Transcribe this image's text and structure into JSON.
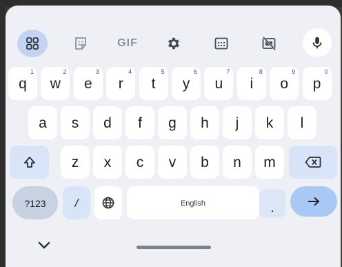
{
  "toolbar": {
    "items": [
      "apps-grid",
      "sticker",
      "gif",
      "settings",
      "clipboard",
      "floating-keyboard",
      "voice-input"
    ],
    "gif_label": "GIF"
  },
  "rows": {
    "row1": [
      {
        "label": "q",
        "hint": "1"
      },
      {
        "label": "w",
        "hint": "2"
      },
      {
        "label": "e",
        "hint": "3"
      },
      {
        "label": "r",
        "hint": "4"
      },
      {
        "label": "t",
        "hint": "5"
      },
      {
        "label": "y",
        "hint": "6"
      },
      {
        "label": "u",
        "hint": "7"
      },
      {
        "label": "i",
        "hint": "8"
      },
      {
        "label": "o",
        "hint": "9"
      },
      {
        "label": "p",
        "hint": "0"
      }
    ],
    "row2": [
      "a",
      "s",
      "d",
      "f",
      "g",
      "h",
      "j",
      "k",
      "l"
    ],
    "row3": [
      "z",
      "x",
      "c",
      "v",
      "b",
      "n",
      "m"
    ],
    "row4": {
      "symbols_label": "?123",
      "slash_label": "/",
      "space_label": "English",
      "period_label": "."
    }
  },
  "colors": {
    "keyboard_bg": "#eef0f6",
    "key_bg": "#ffffff",
    "function_key_bg": "#d8e4f7",
    "enter_key_bg": "#a9c8f4",
    "symbols_key_bg": "#c8d2e2"
  }
}
